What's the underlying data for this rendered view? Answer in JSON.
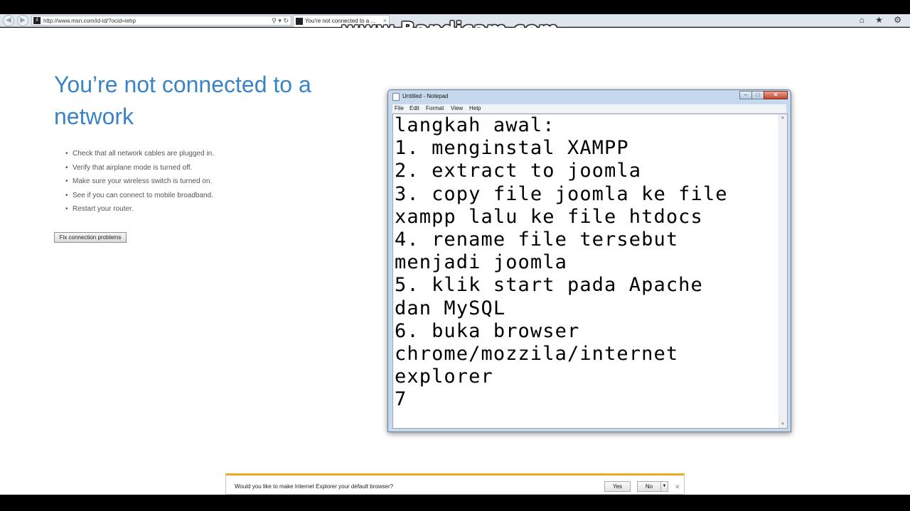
{
  "browser": {
    "address": "http://www.msn.com/id-id/?ocid=iehp",
    "tab_title": "You're not connected to a ...",
    "back_icon": "back-arrow-icon",
    "refresh_icon": "refresh-icon",
    "right_icons": "⌂ ★ ⚙"
  },
  "watermark": "www.Bandicam.com",
  "error_page": {
    "title": "You’re not connected to a network",
    "tips": [
      "Check that all network cables are plugged in.",
      "Verify that airplane mode is turned off.",
      "Make sure your wireless switch is turned on.",
      "See if you can connect to mobile broadband.",
      "Restart your router."
    ],
    "fix_button": "Fix connection problems"
  },
  "notepad": {
    "title": "Untitled - Notepad",
    "menu": [
      "File",
      "Edit",
      "Format",
      "View",
      "Help"
    ],
    "content": "langkah awal:\n1. menginstal XAMPP\n2. extract to joomla\n3. copy file joomla ke file\nxampp lalu ke file htdocs\n4. rename file tersebut\nmenjadi joomla\n5. klik start pada Apache\ndan MySQL\n6. buka browser\nchrome/mozzila/internet\nexplorer\n7"
  },
  "notification": {
    "message": "Would you like to make Internet Explorer your default browser?",
    "yes": "Yes",
    "no": "No",
    "accent": "#f0a81c"
  },
  "colors": {
    "title_blue": "#3a84c6"
  }
}
